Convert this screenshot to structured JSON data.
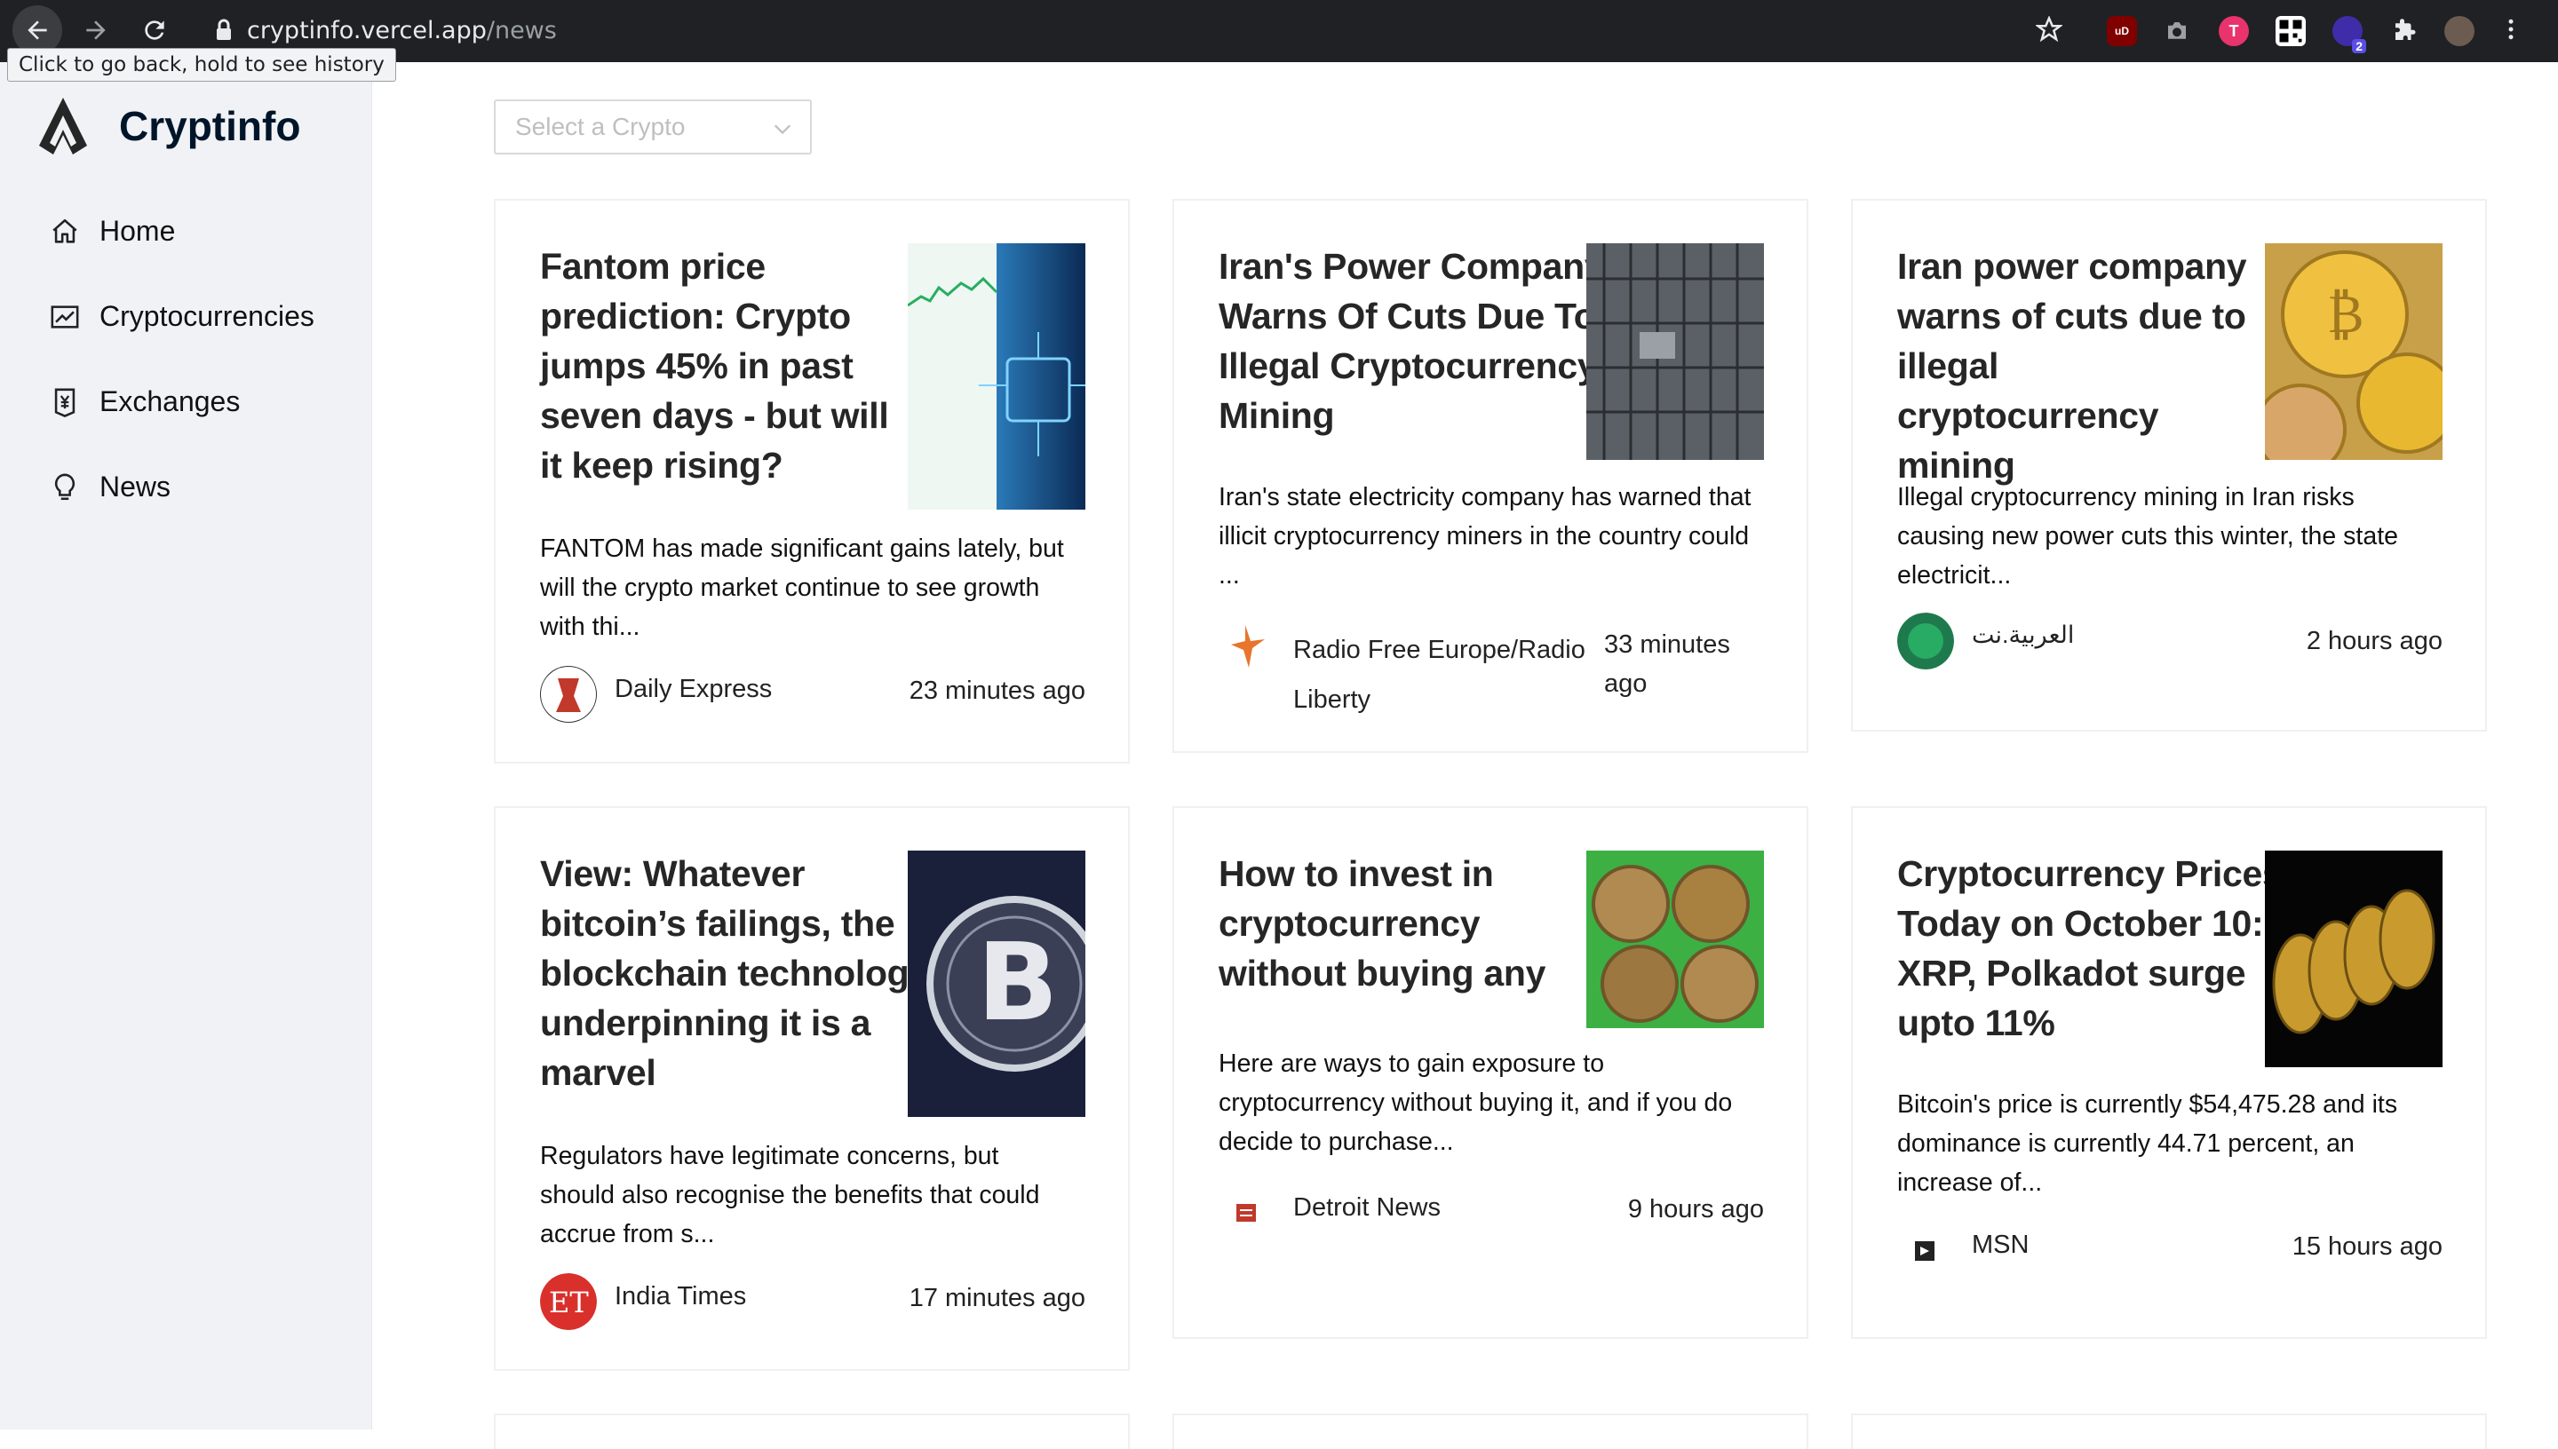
{
  "browser": {
    "url_host": "cryptinfo.vercel.app",
    "url_path": "/news",
    "tooltip": "Click to go back, hold to see history",
    "extension_badge": "2"
  },
  "sidebar": {
    "logo_text": "Cryptinfo",
    "items": [
      {
        "label": "Home",
        "icon": "home-icon"
      },
      {
        "label": "Cryptocurrencies",
        "icon": "fund-icon"
      },
      {
        "label": "Exchanges",
        "icon": "money-collect-icon"
      },
      {
        "label": "News",
        "icon": "bulb-icon"
      }
    ]
  },
  "filter": {
    "placeholder": "Select a Crypto"
  },
  "news": [
    {
      "title": "Fantom price prediction: Crypto jumps 45% in past seven days - but will it keep rising?",
      "description": "FANTOM has made significant gains lately, but will the crypto market continue to see growth with thi...",
      "source": "Daily Express",
      "time": "23 minutes ago"
    },
    {
      "title": "Iran's Power Company Warns Of Cuts Due To Illegal Cryptocurrency Mining",
      "description": "Iran's state electricity company has warned that illicit cryptocurrency miners in the country could ...",
      "source": "Radio Free Europe/Radio Liberty",
      "time": "33 minutes ago"
    },
    {
      "title": "Iran power company warns of cuts due to illegal cryptocurrency mining",
      "description": "Illegal cryptocurrency mining in Iran risks causing new power cuts this winter, the state electricit...",
      "source": "العربية.نت",
      "time": "2 hours ago"
    },
    {
      "title": "View: Whatever bitcoin’s failings, the blockchain technology underpinning it is a marvel",
      "description": "Regulators have legitimate concerns, but should also recognise the benefits that could accrue from s...",
      "source": "India Times",
      "time": "17 minutes ago"
    },
    {
      "title": "How to invest in cryptocurrency without buying any",
      "description": "Here are ways to gain exposure to cryptocurrency without buying it, and if you do decide to purchase...",
      "source": "Detroit News",
      "time": "9 hours ago"
    },
    {
      "title": "Cryptocurrency Prices Today on October 10: XRP, Polkadot surge upto 11%",
      "description": "Bitcoin's price is currently $54,475.28 and its dominance is currently 44.71 percent, an increase of...",
      "source": "MSN",
      "time": "15 hours ago"
    }
  ]
}
